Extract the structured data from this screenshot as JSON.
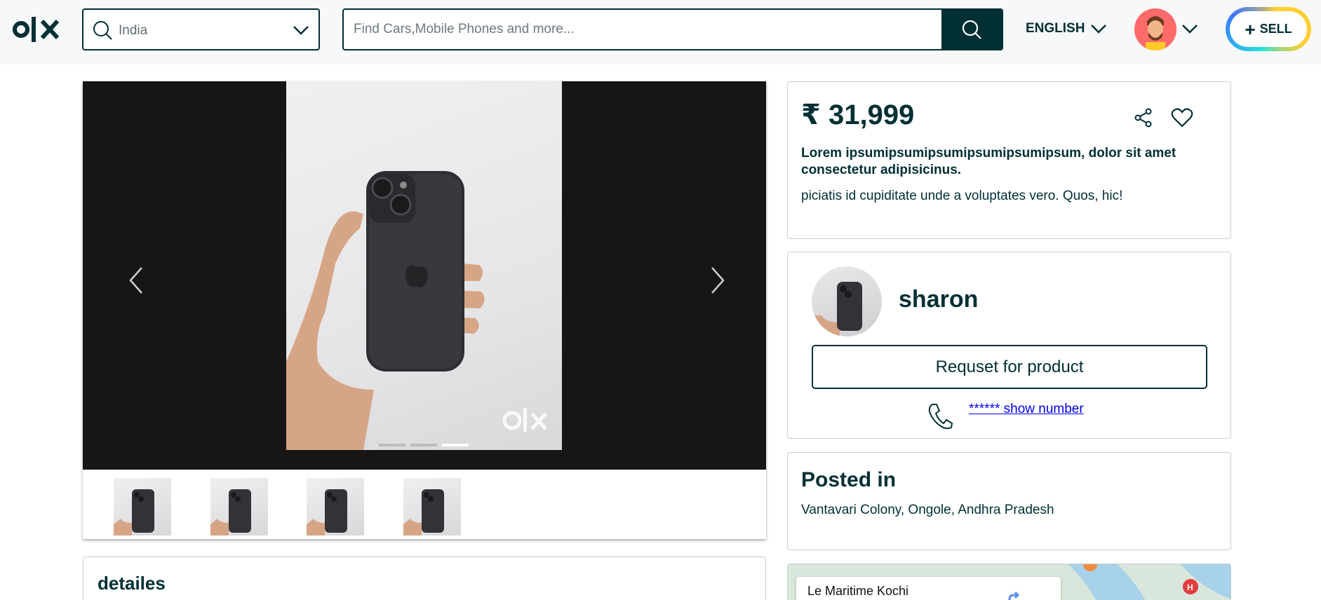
{
  "header": {
    "location": {
      "value": "India"
    },
    "search": {
      "placeholder": "Find Cars,Mobile Phones and more..."
    },
    "language": "ENGLISH",
    "sell_label": "SELL"
  },
  "gallery": {
    "thumbnail_count": 4,
    "active_indicator": 3,
    "indicator_count": 3
  },
  "details": {
    "heading": "detailes"
  },
  "product": {
    "price": "₹ 31,999",
    "title": "Lorem ipsumipsumipsumipsumipsumipsum, dolor sit amet consectetur adipisicinus.",
    "description": "piciatis id cupiditate unde a voluptates vero. Quos, hic!"
  },
  "seller": {
    "name": "sharon",
    "request_label": "Requset for product",
    "show_number_label": "****** show number"
  },
  "posted": {
    "heading": "Posted in",
    "location": "Vantavari Colony, Ongole, Andhra Pradesh"
  },
  "map": {
    "place_label": "Le Maritime Kochi"
  },
  "colors": {
    "primary": "#002f34",
    "link": "#0000ee",
    "gallery_bg": "#171516"
  }
}
